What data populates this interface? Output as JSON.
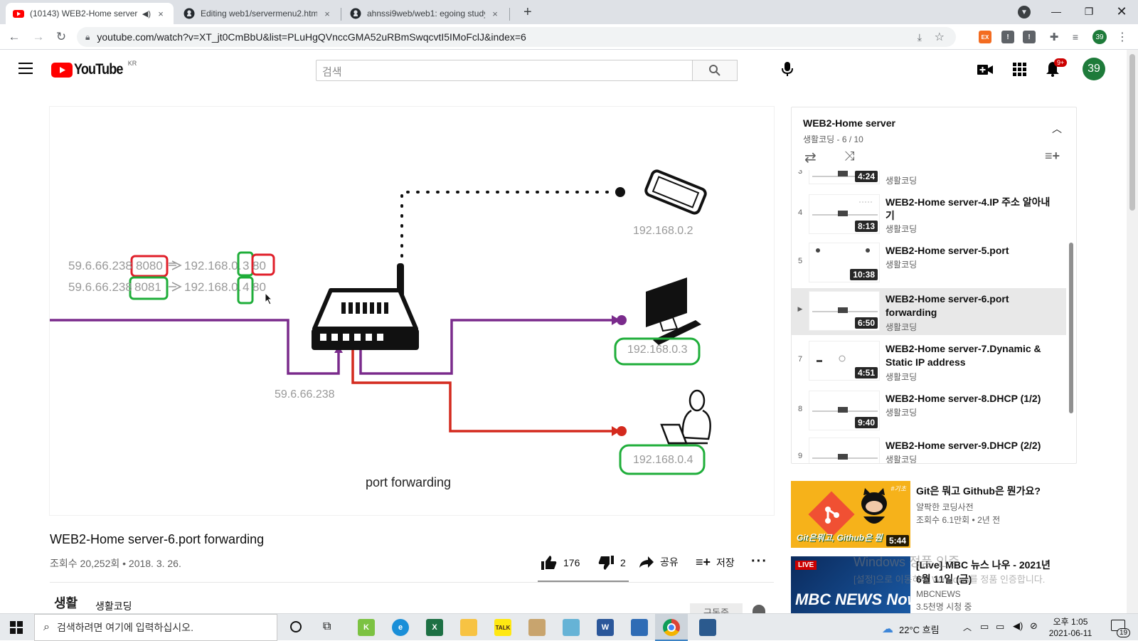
{
  "browser": {
    "tabs": [
      {
        "title": "(10143) WEB2-Home server",
        "close": "×"
      },
      {
        "title": "Editing web1/servermenu2.html",
        "close": "×"
      },
      {
        "title": "ahnssi9web/web1: egoing study",
        "close": "×"
      }
    ],
    "new_tab": "+",
    "url": "youtube.com/watch?v=XT_jt0CmBbU&list=PLuHgQVnccGMA52uRBmSwqcvtI5IMoFclJ&index=6",
    "profile_badge": "39",
    "ext_labels": [
      "EX",
      "!",
      "!"
    ]
  },
  "youtube": {
    "logo_text": "YouTube",
    "region": "KR",
    "search_placeholder": "검색",
    "notif_count": "9+",
    "avatar": "39"
  },
  "figure": {
    "rule1_left_ip": "59.6.66.238",
    "rule1_left_port": "8080",
    "rule1_right_ip": "192.168.0.",
    "rule1_right_mid": "3",
    "rule1_right_port": "80",
    "rule2_left_ip": "59.6.66.238",
    "rule2_left_port": "8081",
    "rule2_right_ip": "192.168.0.",
    "rule2_right_mid": "4",
    "rule2_right_port": "80",
    "phone_ip": "192.168.0.2",
    "pc_ip": "192.168.0.3",
    "laptop_ip": "192.168.0.4",
    "router_ip": "59.6.66.238",
    "caption": "port forwarding"
  },
  "video": {
    "title": "WEB2-Home server-6.port forwarding",
    "meta": "조회수 20,252회 • 2018. 3. 26.",
    "likes": "176",
    "dislikes": "2",
    "share": "공유",
    "save": "저장",
    "channel_name": "생활코딩",
    "channel_logo": "생활",
    "subscribe": "구독중"
  },
  "playlist": {
    "title": "WEB2-Home server",
    "subtitle": "생활코딩 - 6 / 10",
    "items": [
      {
        "idx": "3",
        "title": "",
        "channel": "생활코딩",
        "duration": "4:24"
      },
      {
        "idx": "4",
        "title": "WEB2-Home server-4.IP 주소 알아내기",
        "channel": "생활코딩",
        "duration": "8:13"
      },
      {
        "idx": "5",
        "title": "WEB2-Home server-5.port",
        "channel": "생활코딩",
        "duration": "10:38"
      },
      {
        "idx": "▶",
        "title": "WEB2-Home server-6.port forwarding",
        "channel": "생활코딩",
        "duration": "6:50"
      },
      {
        "idx": "7",
        "title": "WEB2-Home server-7.Dynamic & Static IP address",
        "channel": "생활코딩",
        "duration": "4:51"
      },
      {
        "idx": "8",
        "title": "WEB2-Home server-8.DHCP (1/2)",
        "channel": "생활코딩",
        "duration": "9:40"
      },
      {
        "idx": "9",
        "title": "WEB2-Home server-9.DHCP (2/2)",
        "channel": "생활코딩",
        "duration": ""
      }
    ]
  },
  "recommendations": [
    {
      "title": "Git은 뭐고 Github은 뭔가요?",
      "channel": "얄팍한 코딩사전",
      "meta": "조회수 6.1만회 • 2년 전",
      "duration": "5:44",
      "thumb_text": "Git은뭐고, Github은 뭔",
      "thumb_tag": "#기초"
    },
    {
      "title": "[Live] MBC 뉴스 나우 - 2021년 6월 11일 (금)",
      "channel": "MBCNEWS",
      "meta": "3.5천명 시청 중",
      "live": "LIVE",
      "thumb_text": "MBC NEWS Now"
    }
  ],
  "watermark": {
    "line1": "Windows 정품 인증",
    "line2": "[설정]으로 이동하여 Windows를 정품 인증합니다."
  },
  "taskbar": {
    "search_placeholder": "검색하려면 여기에 입력하십시오.",
    "weather": "22°C 흐림",
    "time": "오후 1:05",
    "date": "2021-06-11",
    "notif": "19",
    "apps": [
      "K",
      "e",
      "X",
      "",
      "TALK",
      "",
      "",
      "W",
      "",
      "",
      ""
    ]
  }
}
